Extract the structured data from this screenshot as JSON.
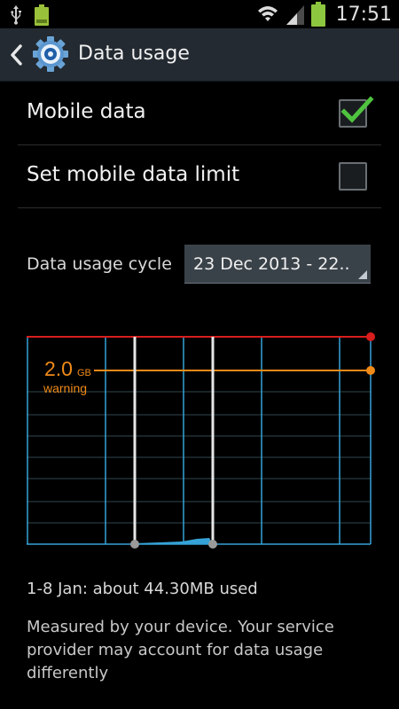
{
  "status_bar": {
    "time": "17:51",
    "icons": [
      "usb-icon",
      "battery-full-notification-icon",
      "wifi-icon",
      "signal-icon",
      "battery-icon"
    ]
  },
  "action_bar": {
    "title": "Data usage",
    "back_icon": "chevron-left-icon",
    "app_icon": "gear-icon"
  },
  "settings": [
    {
      "label": "Mobile data",
      "checked": true
    },
    {
      "label": "Set mobile data limit",
      "checked": false
    }
  ],
  "cycle": {
    "label": "Data usage cycle",
    "value": "23 Dec 2013 - 22.."
  },
  "chart": {
    "warning_value": "2.0",
    "warning_unit": "GB",
    "warning_label": "warning",
    "colors": {
      "limit": "#d81d1d",
      "warning": "#f08a18",
      "grid_vertical": "#35a3d8",
      "grid_horizontal": "#2f4750",
      "usage": "#35a3d8",
      "handle": "#e6e6e6"
    }
  },
  "chart_data": {
    "type": "area",
    "warning_level_gb": 2.0,
    "selected_range": "1-8 Jan",
    "used_mb": 44.3
  },
  "summary": {
    "usage_text": "1-8 Jan: about 44.30MB used",
    "note": "Measured by your device. Your service provider may account for data usage differently"
  }
}
